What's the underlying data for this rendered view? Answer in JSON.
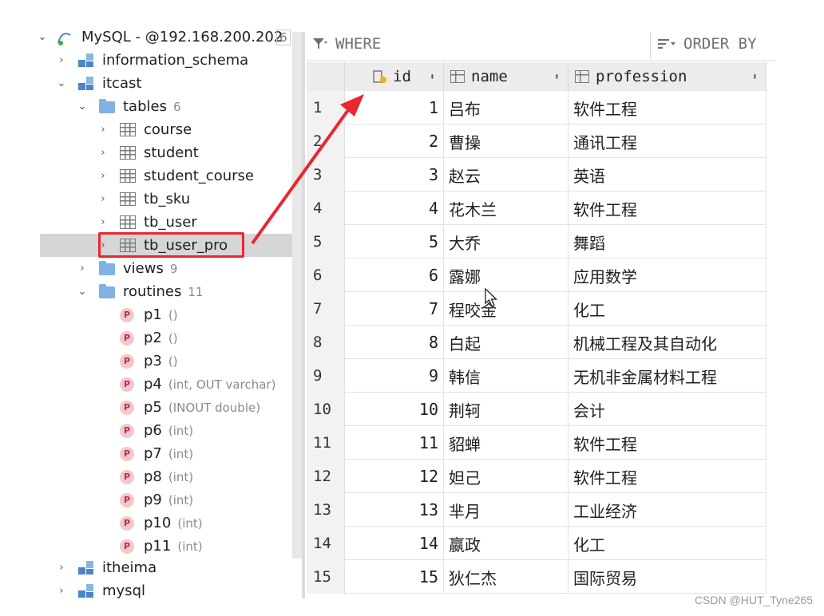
{
  "tree": {
    "connection": {
      "label": "MySQL - @192.168.200.202",
      "badge": "6"
    },
    "schemas": {
      "information_schema": "information_schema",
      "itcast": "itcast",
      "itheima": "itheima",
      "mysql": "mysql"
    },
    "tables_folder": {
      "label": "tables",
      "count": "6"
    },
    "tables": [
      "course",
      "student",
      "student_course",
      "tb_sku",
      "tb_user",
      "tb_user_pro"
    ],
    "views_folder": {
      "label": "views",
      "count": "9"
    },
    "routines_folder": {
      "label": "routines",
      "count": "11"
    },
    "routines": [
      {
        "name": "p1",
        "sig": "()"
      },
      {
        "name": "p2",
        "sig": "()"
      },
      {
        "name": "p3",
        "sig": "()"
      },
      {
        "name": "p4",
        "sig": "(int, OUT varchar)"
      },
      {
        "name": "p5",
        "sig": "(INOUT double)"
      },
      {
        "name": "p6",
        "sig": "(int)"
      },
      {
        "name": "p7",
        "sig": "(int)"
      },
      {
        "name": "p8",
        "sig": "(int)"
      },
      {
        "name": "p9",
        "sig": "(int)"
      },
      {
        "name": "p10",
        "sig": "(int)"
      },
      {
        "name": "p11",
        "sig": "(int)"
      }
    ],
    "routine_icon_letter": "P"
  },
  "toolbar": {
    "where": "WHERE",
    "order_by": "ORDER BY"
  },
  "grid": {
    "columns": [
      "id",
      "name",
      "profession"
    ],
    "rows": [
      {
        "n": "1",
        "id": "1",
        "name": "吕布",
        "profession": "软件工程"
      },
      {
        "n": "2",
        "id": "2",
        "name": "曹操",
        "profession": "通讯工程"
      },
      {
        "n": "3",
        "id": "3",
        "name": "赵云",
        "profession": "英语"
      },
      {
        "n": "4",
        "id": "4",
        "name": "花木兰",
        "profession": "软件工程"
      },
      {
        "n": "5",
        "id": "5",
        "name": "大乔",
        "profession": "舞蹈"
      },
      {
        "n": "6",
        "id": "6",
        "name": "露娜",
        "profession": "应用数学"
      },
      {
        "n": "7",
        "id": "7",
        "name": "程咬金",
        "profession": "化工"
      },
      {
        "n": "8",
        "id": "8",
        "name": "白起",
        "profession": "机械工程及其自动化"
      },
      {
        "n": "9",
        "id": "9",
        "name": "韩信",
        "profession": "无机非金属材料工程"
      },
      {
        "n": "10",
        "id": "10",
        "name": "荆轲",
        "profession": "会计"
      },
      {
        "n": "11",
        "id": "11",
        "name": "貂蝉",
        "profession": "软件工程"
      },
      {
        "n": "12",
        "id": "12",
        "name": "妲己",
        "profession": "软件工程"
      },
      {
        "n": "13",
        "id": "13",
        "name": "芈月",
        "profession": "工业经济"
      },
      {
        "n": "14",
        "id": "14",
        "name": "嬴政",
        "profession": "化工"
      },
      {
        "n": "15",
        "id": "15",
        "name": "狄仁杰",
        "profession": "国际贸易"
      }
    ]
  },
  "watermark": "CSDN @HUT_Tyne265",
  "colors": {
    "annotation": "#e8272f",
    "selection": "#d6d6d6"
  }
}
